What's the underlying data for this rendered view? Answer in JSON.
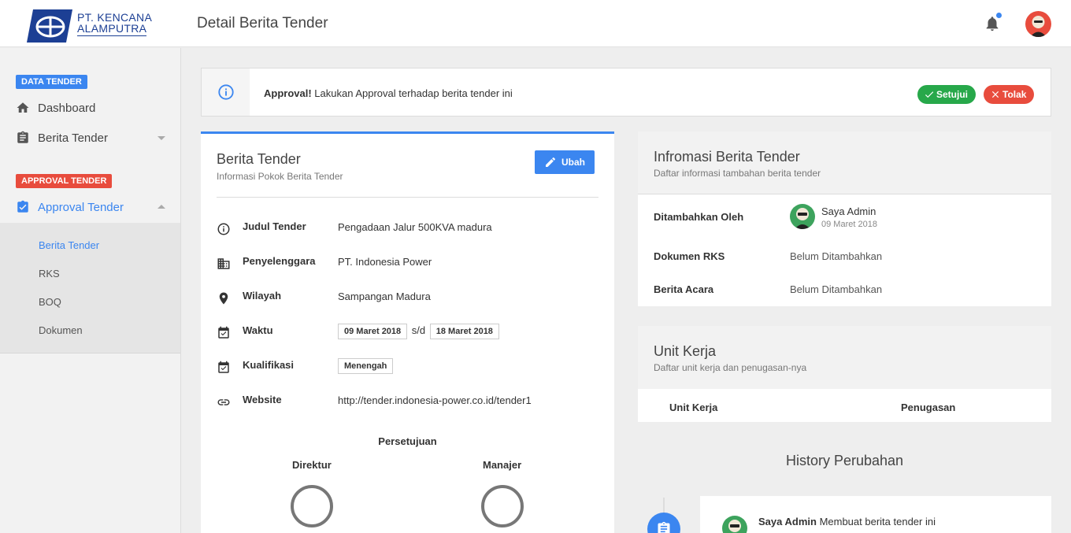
{
  "brand": {
    "line1": "PT. KENCANA",
    "line2": "ALAMPUTRA"
  },
  "header": {
    "title": "Detail Berita Tender"
  },
  "sidebar": {
    "sections": [
      {
        "tag": "DATA TENDER",
        "color": "#3b86f0"
      },
      {
        "tag": "APPROVAL TENDER",
        "color": "#e84c3d"
      }
    ],
    "items": [
      {
        "label": "Dashboard",
        "icon": "home-icon"
      },
      {
        "label": "Berita Tender",
        "icon": "clipboard-icon"
      },
      {
        "label": "Approval Tender",
        "icon": "check-square-icon",
        "active": true
      }
    ],
    "subitems": [
      {
        "label": "Berita Tender",
        "active": true
      },
      {
        "label": "RKS"
      },
      {
        "label": "BOQ"
      },
      {
        "label": "Dokumen"
      }
    ]
  },
  "alert": {
    "strong": "Approval!",
    "text": "Lakukan Approval terhadap berita tender ini",
    "approve_label": "Setujui",
    "reject_label": "Tolak"
  },
  "main_card": {
    "title": "Berita Tender",
    "subtitle": "Informasi Pokok Berita Tender",
    "edit_label": "Ubah",
    "fields": {
      "judul": {
        "label": "Judul Tender",
        "value": "Pengadaan Jalur 500KVA madura"
      },
      "penyelenggara": {
        "label": "Penyelenggara",
        "value": "PT. Indonesia Power"
      },
      "wilayah": {
        "label": "Wilayah",
        "value": "Sampangan Madura"
      },
      "waktu": {
        "label": "Waktu",
        "start": "09 Maret 2018",
        "sep": "s/d",
        "end": "18 Maret 2018"
      },
      "kualifikasi": {
        "label": "Kualifikasi",
        "value": "Menengah"
      },
      "website": {
        "label": "Website",
        "value": "http://tender.indonesia-power.co.id/tender1"
      }
    },
    "approval": {
      "title": "Persetujuan",
      "left": "Direktur",
      "right": "Manajer"
    }
  },
  "info_card": {
    "title": "Infromasi Berita Tender",
    "subtitle": "Daftar informasi tambahan berita tender",
    "added_by_label": "Ditambahkan Oleh",
    "added_by_name": "Saya Admin",
    "added_by_date": "09 Maret 2018",
    "rks_label": "Dokumen RKS",
    "rks_value": "Belum Ditambahkan",
    "ba_label": "Berita Acara",
    "ba_value": "Belum Ditambahkan"
  },
  "unit_card": {
    "title": "Unit Kerja",
    "subtitle": "Daftar unit kerja dan penugasan-nya",
    "col1": "Unit Kerja",
    "col2": "Penugasan"
  },
  "history": {
    "title": "History Perubahan",
    "entry_user": "Saya Admin",
    "entry_text": "Membuat berita tender ini"
  },
  "colors": {
    "accent": "#3b86f0",
    "success": "#27a84a",
    "danger": "#e84c3d"
  }
}
